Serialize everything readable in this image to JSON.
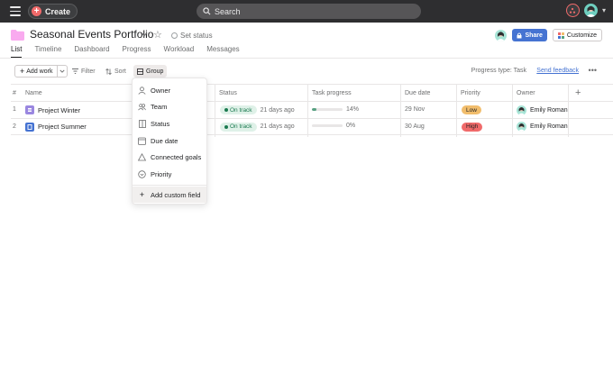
{
  "topbar": {
    "create_label": "Create",
    "search_label": "Search"
  },
  "header": {
    "title": "Seasonal Events Portfolio",
    "set_status": "Set status",
    "share_label": "Share",
    "customize_label": "Customize"
  },
  "tabs": [
    {
      "label": "List",
      "active": true
    },
    {
      "label": "Timeline",
      "active": false
    },
    {
      "label": "Dashboard",
      "active": false
    },
    {
      "label": "Progress",
      "active": false
    },
    {
      "label": "Workload",
      "active": false
    },
    {
      "label": "Messages",
      "active": false
    }
  ],
  "toolbar": {
    "add_work_label": "Add work",
    "filter_label": "Filter",
    "sort_label": "Sort",
    "group_label": "Group",
    "progress_type": "Progress type: Task",
    "feedback_label": "Send feedback"
  },
  "table": {
    "headers": {
      "num": "#",
      "name": "Name",
      "status": "Status",
      "progress": "Task progress",
      "due": "Due date",
      "priority": "Priority",
      "owner": "Owner"
    },
    "rows": [
      {
        "num": "1",
        "name": "Project Winter",
        "status": "On track",
        "updated": "21 days ago",
        "progress_pct": "14%",
        "progress_value": 14,
        "due": "29 Nov",
        "priority": "Low",
        "owner": "Emily Roman",
        "icon_color": "#9a87e0"
      },
      {
        "num": "2",
        "name": "Project Summer",
        "status": "On track",
        "updated": "21 days ago",
        "progress_pct": "0%",
        "progress_value": 0,
        "due": "30 Aug",
        "priority": "High",
        "owner": "Emily Roman",
        "icon_color": "#4573d2"
      }
    ]
  },
  "group_menu": {
    "items": [
      {
        "label": "Owner",
        "icon": "person-icon"
      },
      {
        "label": "Team",
        "icon": "team-icon"
      },
      {
        "label": "Status",
        "icon": "status-icon"
      },
      {
        "label": "Due date",
        "icon": "calendar-icon"
      },
      {
        "label": "Connected goals",
        "icon": "goal-icon"
      },
      {
        "label": "Priority",
        "icon": "priority-icon"
      }
    ],
    "add_custom_field": "Add custom field"
  },
  "colors": {
    "brand_coral": "#f06a6a",
    "share_blue": "#4573d2",
    "folder_pink": "#f9aaef",
    "on_track_green": "#1b7a50"
  }
}
